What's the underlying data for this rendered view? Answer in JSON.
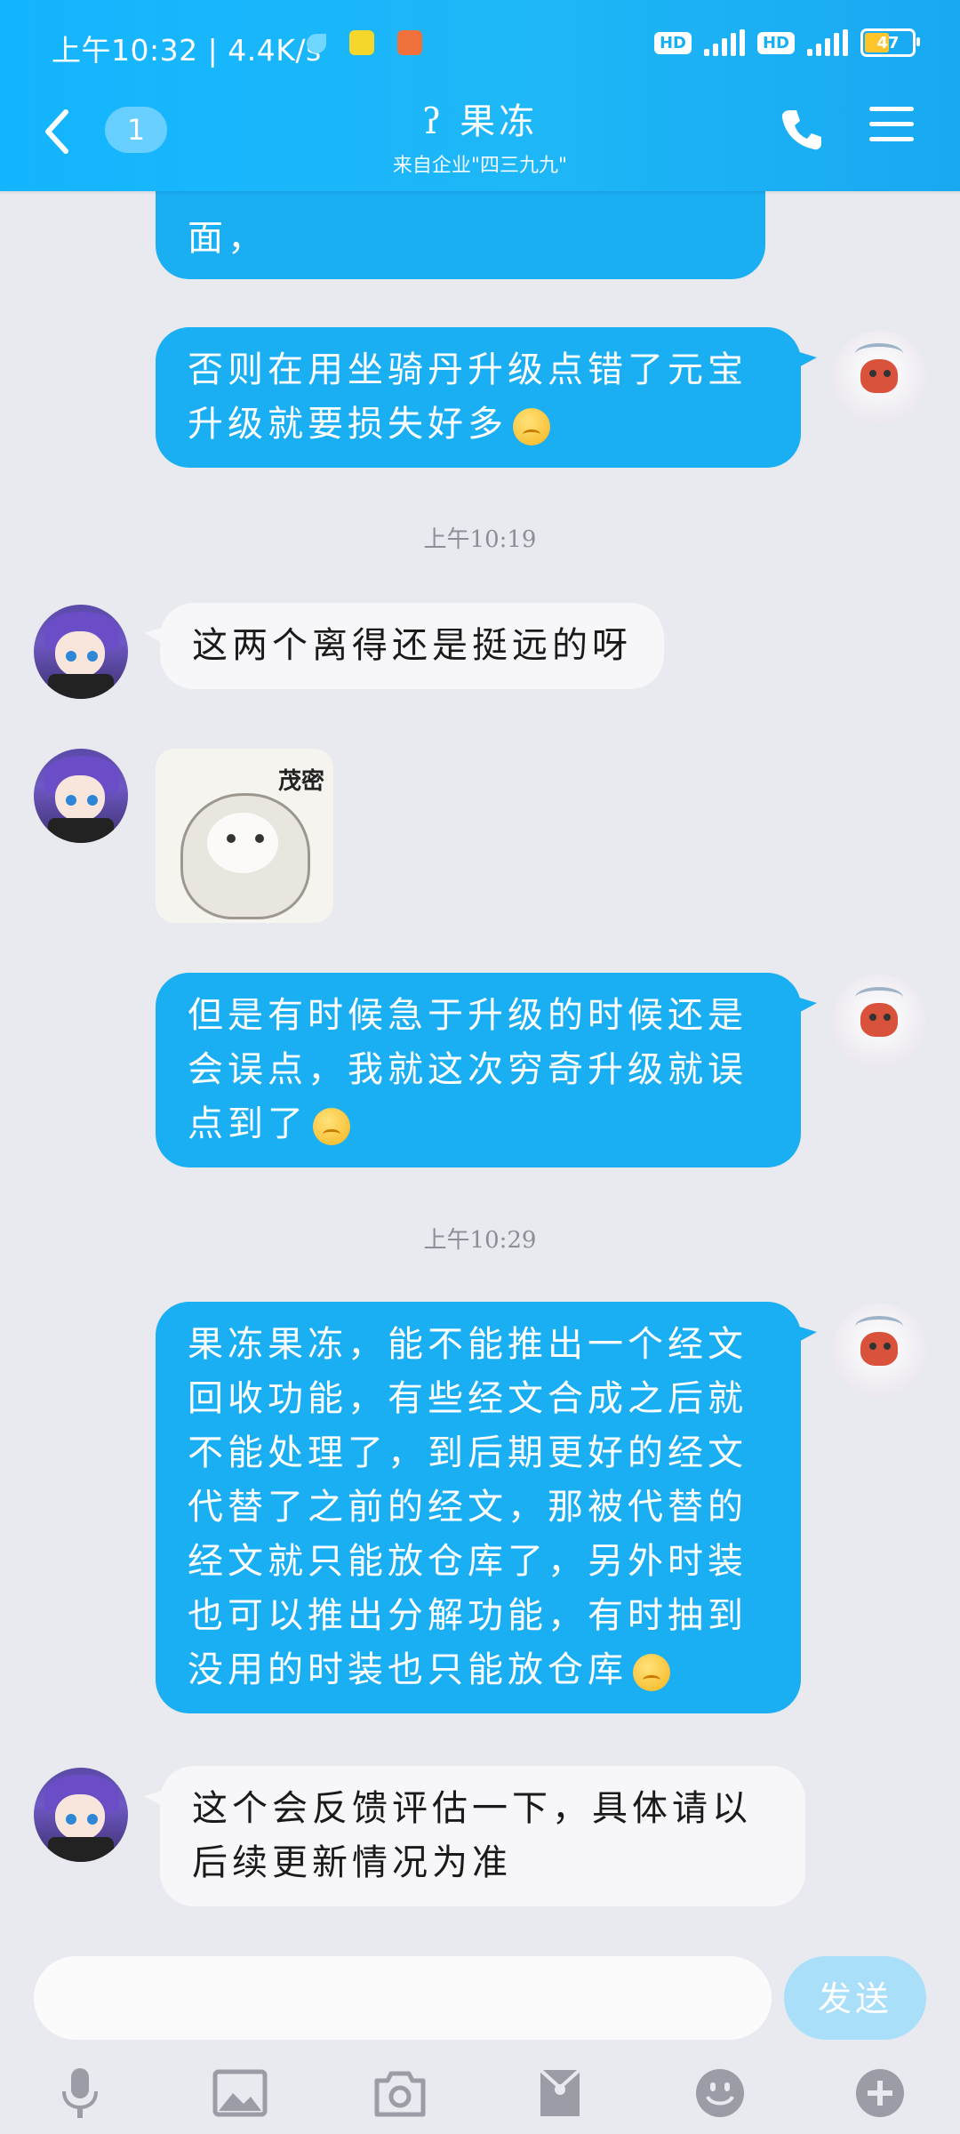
{
  "status_bar": {
    "time": "上午10:32",
    "speed": "4.4K/s",
    "network1": "4G",
    "network2": "4G",
    "hd": "HD",
    "battery": "47"
  },
  "header": {
    "back_icon": "chevron-left-icon",
    "unread_count": "1",
    "title": "果冻",
    "title_icon": "ear-icon",
    "subtitle": "来自企业\"四三九九\"",
    "phone_icon": "phone-icon",
    "menu_icon": "menu-icon"
  },
  "messages": [
    {
      "side": "out",
      "text": "面，",
      "partial": true
    },
    {
      "side": "out",
      "text": "否则在用坐骑丹升级点错了元宝升级就要损失好多",
      "emoji": "sad-face-emoji"
    },
    {
      "type": "time",
      "text": "上午10:19"
    },
    {
      "side": "in",
      "text": "这两个离得还是挺远的呀"
    },
    {
      "side": "in",
      "type": "sticker",
      "sticker_text": "茂密"
    },
    {
      "side": "out",
      "text": "但是有时候急于升级的时候还是会误点，我就这次穷奇升级就误点到了",
      "emoji": "smile-face-emoji"
    },
    {
      "type": "time",
      "text": "上午10:29"
    },
    {
      "side": "out",
      "text": "果冻果冻，能不能推出一个经文回收功能，有些经文合成之后就不能处理了，到后期更好的经文代替了之前的经文，那被代替的经文就只能放仓库了，另外时装也可以推出分解功能，有时抽到没用的时装也只能放仓库",
      "emoji": "sad-face-emoji"
    },
    {
      "side": "in",
      "text": "这个会反馈评估一下，具体请以后续更新情况为准"
    }
  ],
  "input": {
    "placeholder": "",
    "send_label": "发送"
  },
  "toolbar": [
    "microphone-icon",
    "image-icon",
    "camera-icon",
    "red-packet-icon",
    "emoji-icon",
    "plus-icon"
  ],
  "colors": {
    "header": "#18b0f5",
    "outgoing_bubble": "#1aaef3",
    "incoming_bubble": "#f7f7f9",
    "background": "#e9eaef"
  }
}
